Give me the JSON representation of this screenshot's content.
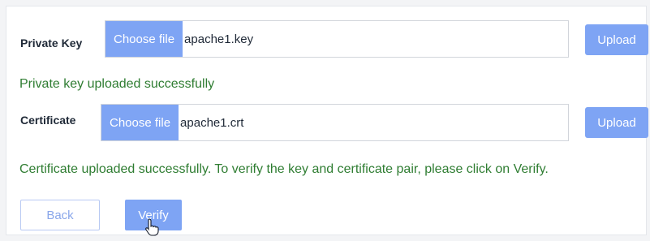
{
  "private_key": {
    "label": "Private Key",
    "choose_label": "Choose file",
    "file_name": "apache1.key",
    "upload_label": "Upload",
    "status": "Private key uploaded successfully"
  },
  "certificate": {
    "label": "Certificate",
    "choose_label": "Choose file",
    "file_name": "apache1.crt",
    "upload_label": "Upload",
    "status": "Certificate uploaded successfully. To verify the key and certificate pair, please click on Verify."
  },
  "actions": {
    "back_label": "Back",
    "verify_label": "Verify"
  },
  "colors": {
    "accent": "#7ea4f4",
    "success": "#2f7d32"
  }
}
